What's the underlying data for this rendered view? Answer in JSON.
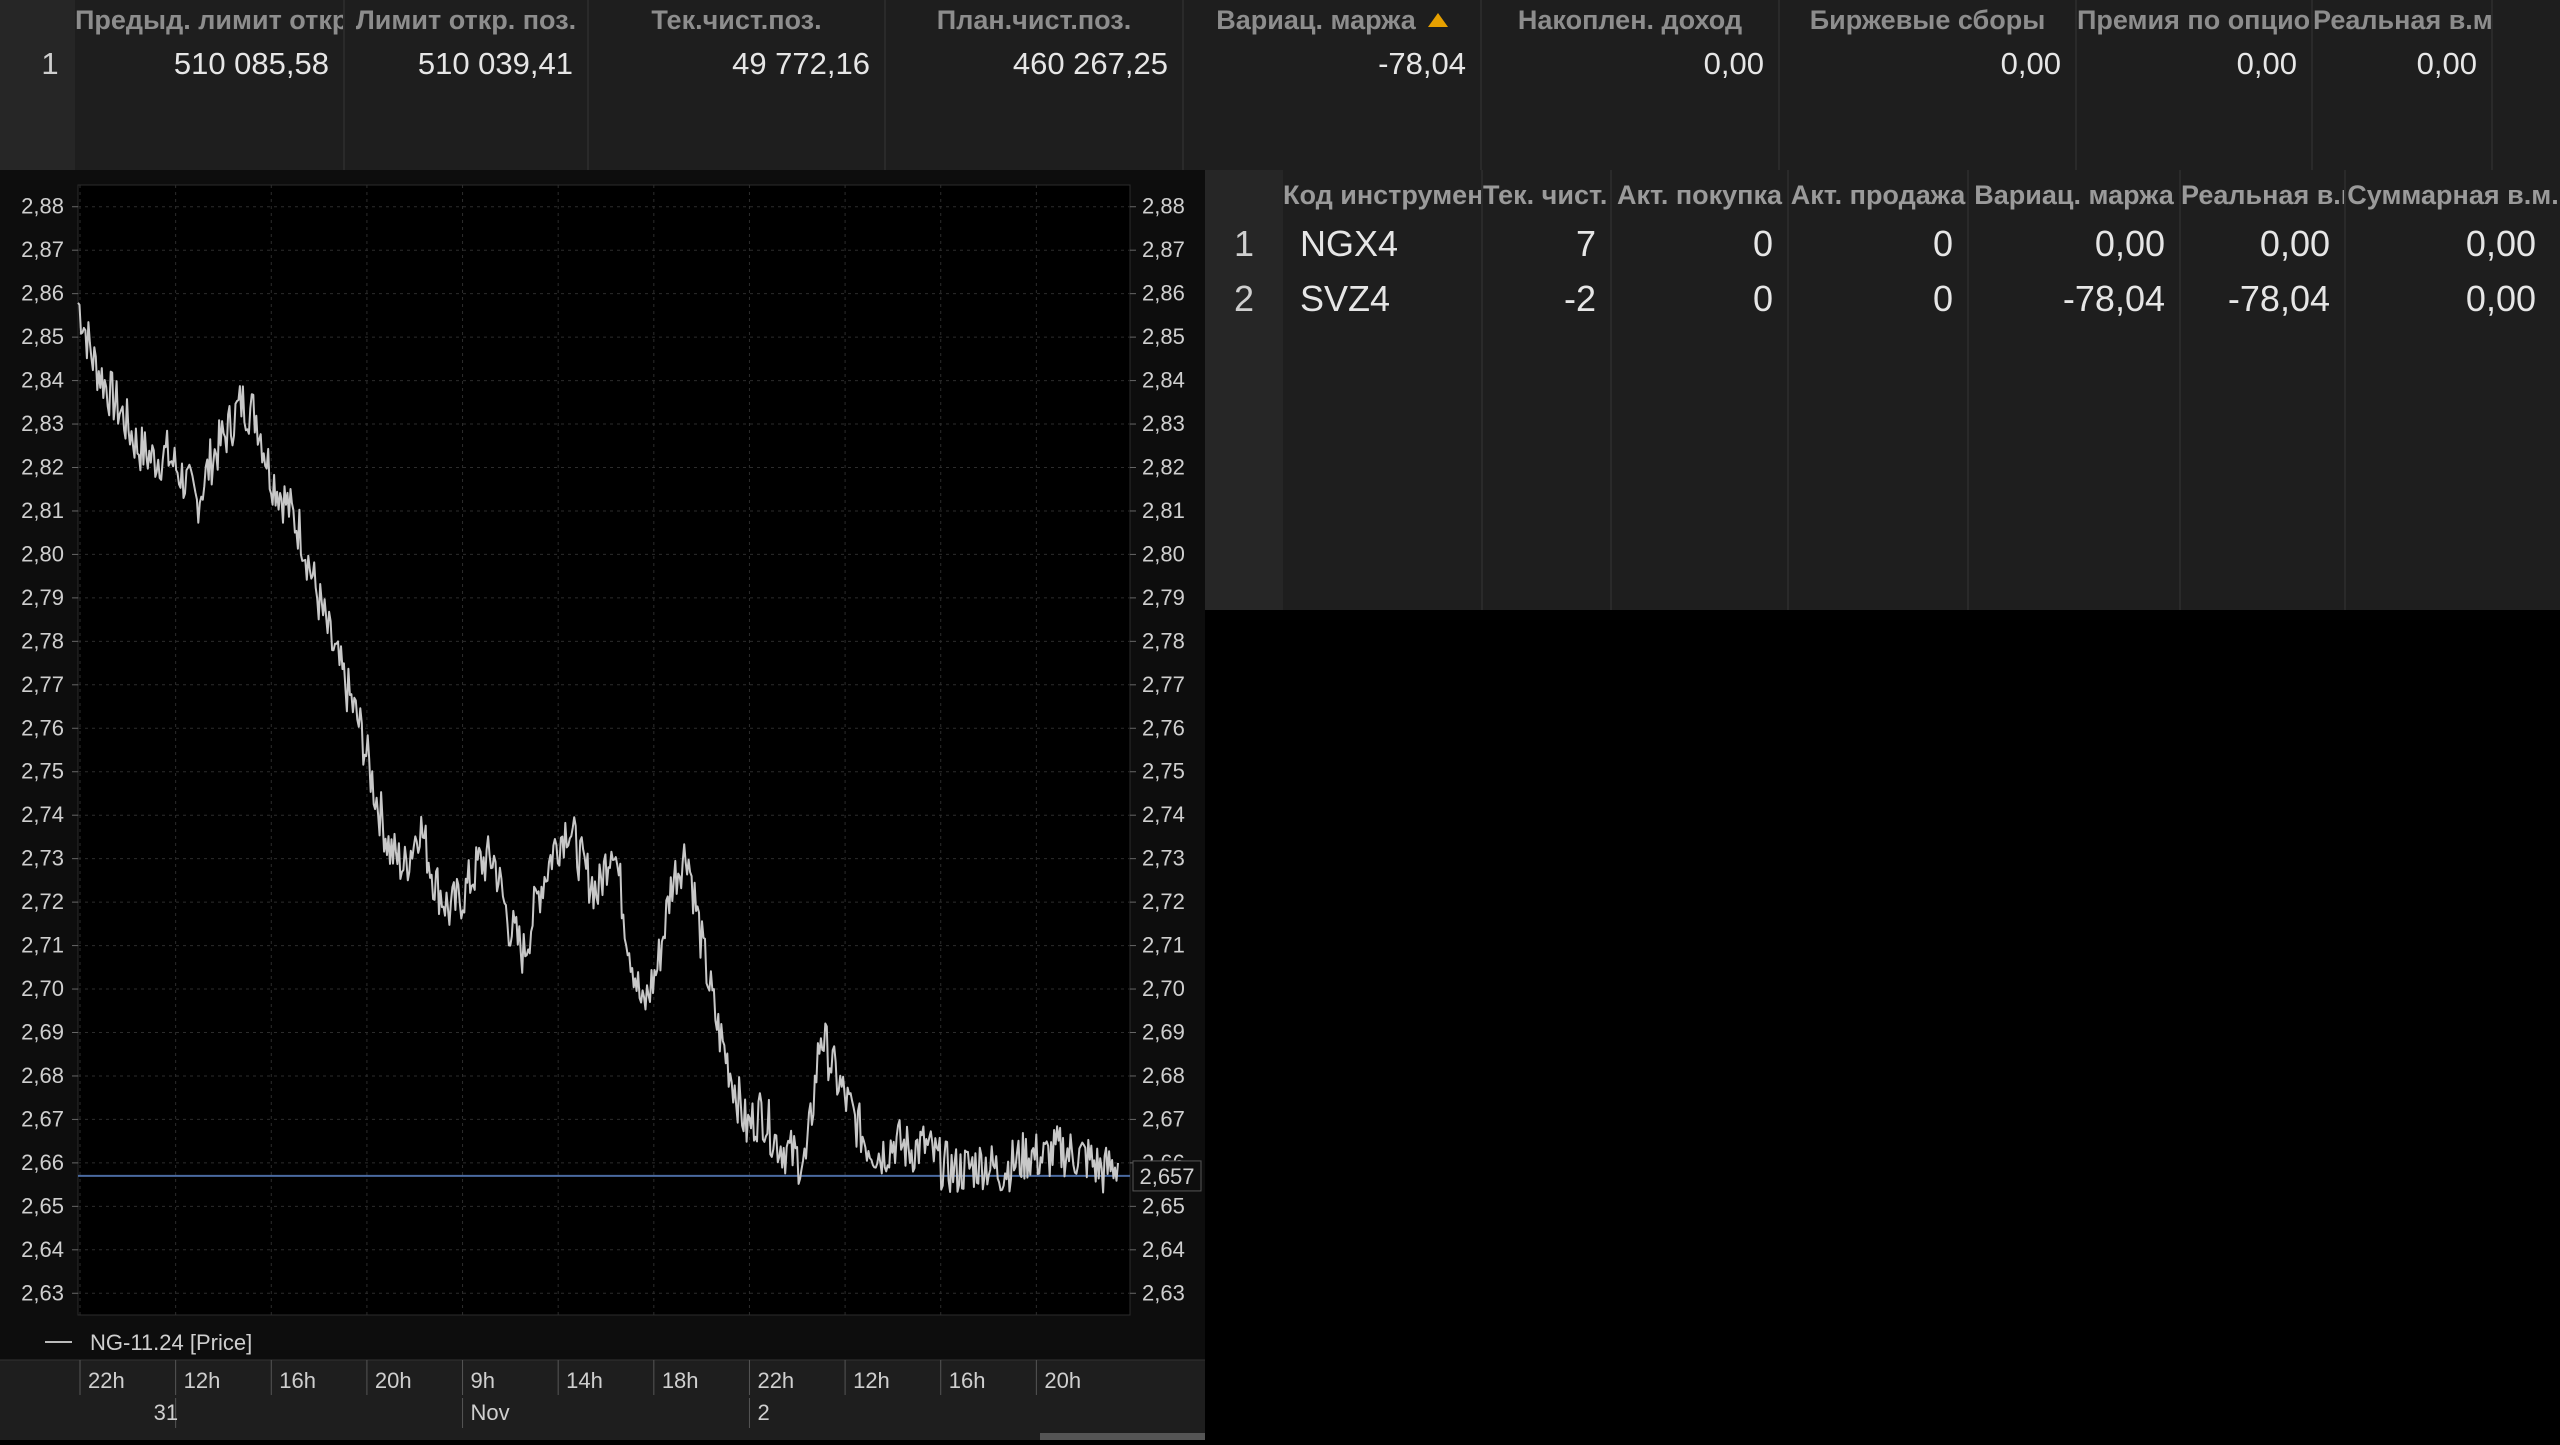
{
  "account_table": {
    "headers": [
      "Предыд. лимит откр. поз.",
      "Лимит откр. поз.",
      "Тек.чист.поз.",
      "План.чист.поз.",
      "Вариац. маржа",
      "Накоплен. доход",
      "Биржевые сборы",
      "Премия по опционам",
      "Реальная в.м."
    ],
    "rows": [
      {
        "num": "1",
        "cells": [
          "510 085,58",
          "510 039,41",
          "49 772,16",
          "460 267,25",
          "-78,04",
          "0,00",
          "0,00",
          "0,00",
          "0,00"
        ]
      }
    ],
    "sorted_column": "Вариац. маржа"
  },
  "positions_table": {
    "headers": [
      "Код инструмента",
      "Тек. чист. поз.",
      "Акт. покупка",
      "Акт. продажа",
      "Вариац. маржа",
      "Реальная в.м.",
      "Суммарная в.м."
    ],
    "rows": [
      {
        "num": "1",
        "cells": [
          "NGX4",
          "7",
          "0",
          "0",
          "0,00",
          "0,00",
          "0,00"
        ]
      },
      {
        "num": "2",
        "cells": [
          "SVZ4",
          "-2",
          "0",
          "0",
          "-78,04",
          "-78,04",
          "0,00"
        ]
      }
    ]
  },
  "chart": {
    "legend": "NG-11.24 [Price]",
    "current_price_label": "2,657",
    "y_tick_labels": [
      "2,88",
      "2,87",
      "2,86",
      "2,85",
      "2,84",
      "2,83",
      "2,82",
      "2,81",
      "2,80",
      "2,79",
      "2,78",
      "2,77",
      "2,76",
      "2,75",
      "2,74",
      "2,73",
      "2,72",
      "2,71",
      "2,70",
      "2,69",
      "2,68",
      "2,67",
      "2,66",
      "2,65",
      "2,64",
      "2,63"
    ],
    "x_tick_labels": [
      "22h",
      "12h",
      "16h",
      "20h",
      "9h",
      "14h",
      "18h",
      "22h",
      "12h",
      "16h",
      "20h"
    ],
    "date_labels": [
      "31",
      "Nov",
      "2"
    ],
    "colors": {
      "price_line": "#c8c8c8",
      "current_price_line": "#4a6aa0",
      "grid": "#2c2c2c"
    }
  },
  "chart_data": {
    "type": "line",
    "title": "",
    "series": [
      {
        "name": "NG-11.24 [Price]",
        "values": [
          2.858,
          2.845,
          2.838,
          2.832,
          2.825,
          2.822,
          2.823,
          2.818,
          2.812,
          2.822,
          2.828,
          2.835,
          2.832,
          2.818,
          2.812,
          2.805,
          2.792,
          2.78,
          2.77,
          2.76,
          2.745,
          2.732,
          2.728,
          2.738,
          2.725,
          2.718,
          2.722,
          2.729,
          2.73,
          2.715,
          2.708,
          2.722,
          2.732,
          2.738,
          2.728,
          2.722,
          2.735,
          2.712,
          2.695,
          2.705,
          2.725,
          2.732,
          2.71,
          2.692,
          2.68,
          2.668,
          2.672,
          2.665,
          2.662,
          2.66,
          2.69,
          2.68,
          2.672,
          2.665,
          2.662,
          2.665,
          2.663,
          2.664,
          2.66,
          2.658,
          2.659,
          2.66,
          2.658,
          2.66,
          2.662,
          2.661,
          2.663,
          2.662,
          2.661,
          2.658,
          2.66
        ]
      }
    ],
    "ylim": [
      2.625,
      2.885
    ],
    "current_price": 2.657,
    "grid": true
  }
}
